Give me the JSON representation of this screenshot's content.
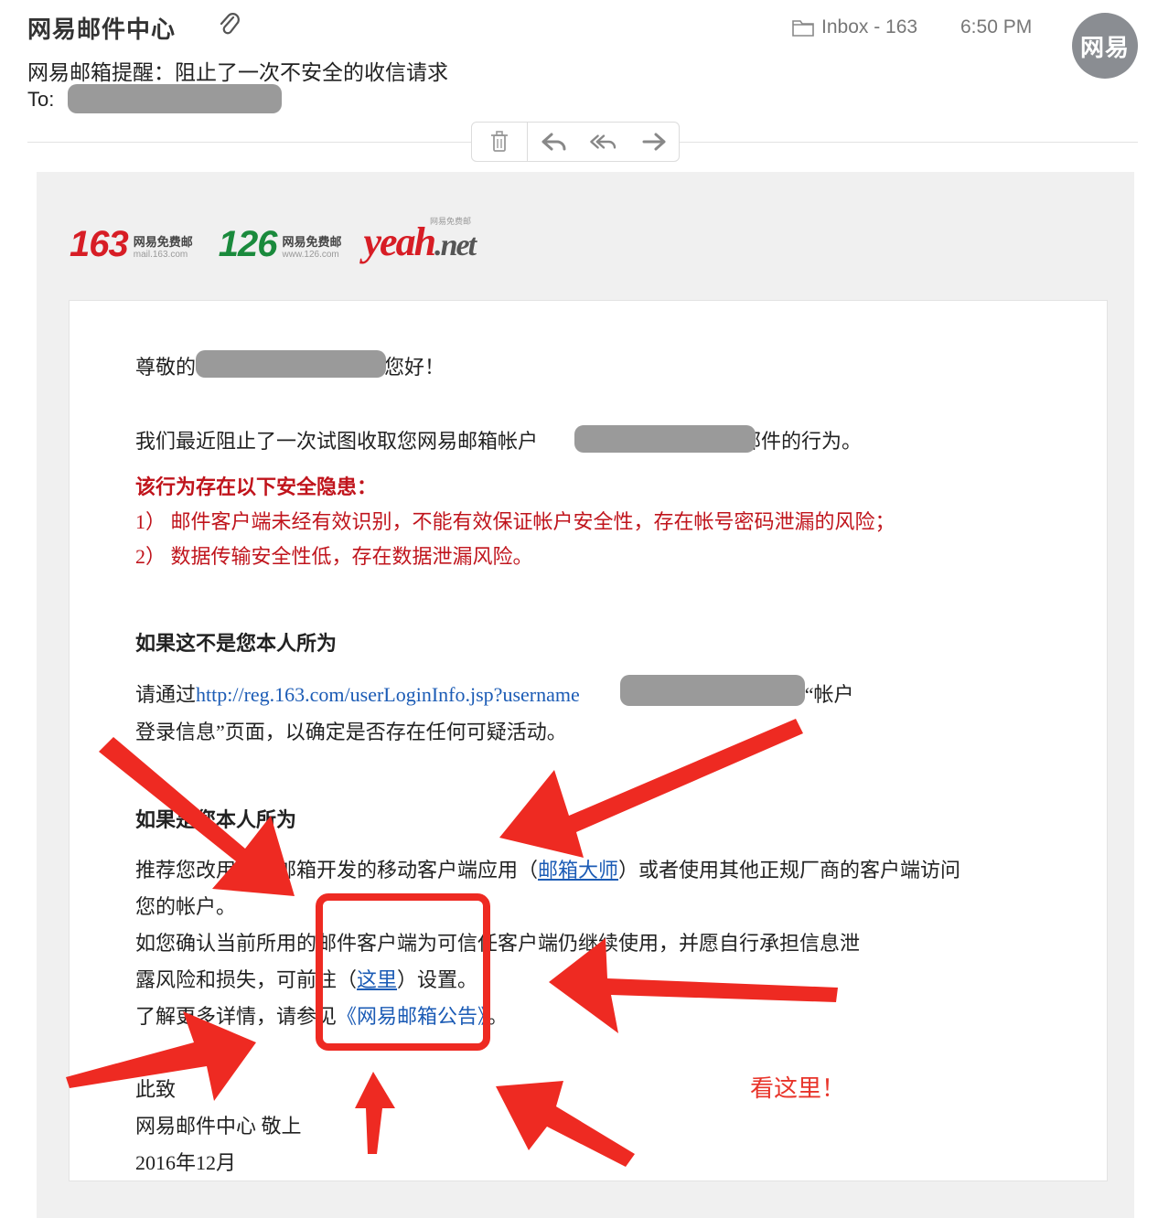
{
  "header": {
    "sender": "网易邮件中心",
    "subject": "网易邮箱提醒：阻止了一次不安全的收信请求",
    "to_label": "To:",
    "mailbox": "Inbox - 163",
    "time": "6:50 PM",
    "avatar_text": "网易"
  },
  "toolbar": {
    "icons": [
      "trash-icon",
      "reply-icon",
      "reply-all-icon",
      "forward-icon"
    ]
  },
  "brands": {
    "b163": {
      "num": "163",
      "cn": "网易免费邮",
      "url": "mail.163.com",
      "color": "#d71d25"
    },
    "b126": {
      "num": "126",
      "cn": "网易免费邮",
      "url": "www.126.com",
      "color": "#1a8a3c"
    },
    "yeah": {
      "main": "yeah",
      "dot": ".net",
      "small": "网易免费邮"
    }
  },
  "body": {
    "greeting_pre": "尊敬的",
    "greeting_post": "您好！",
    "line1_pre": "我们最近阻止了一次试图收取您网易邮箱帐户",
    "line1_post": "内邮件的行为。",
    "risk_title": "该行为存在以下安全隐患：",
    "risk1": "1） 邮件客户端未经有效识别，不能有效保证帐户安全性，存在帐号密码泄漏的风险；",
    "risk2": "2） 数据传输安全性低，存在数据泄漏风险。",
    "h_not_me": "如果这不是您本人所为",
    "check_pre": "请通过",
    "check_link": "http://reg.163.com/userLoginInfo.jsp?username",
    "check_post": "查看“帐户",
    "check_line2": "登录信息”页面，以确定是否存在任何可疑活动。",
    "h_is_me": "如果是您本人所为",
    "rec_pre": "推荐您改用网易邮箱开发的移动客户端应用（",
    "rec_link": "邮箱大师",
    "rec_post": "）或者使用其他正规厂商的客户端访问",
    "rec_line2": "您的帐户。",
    "confirm_line1": "如您确认当前所用的邮件客户端为可信任客户端仍继续使用，并愿自行承担信息泄",
    "confirm_pre": "露风险和损失，可前往（",
    "confirm_link": "这里",
    "confirm_post": "）设置。",
    "more_pre": "了解更多详情，请参见",
    "more_link": "《网易邮箱公告》",
    "more_post": "。",
    "sign1": "此致",
    "sign2": "网易邮件中心 敬上",
    "sign3": "2016年12月"
  },
  "annotation": {
    "note": "看这里！",
    "color": "#ee2a22"
  }
}
